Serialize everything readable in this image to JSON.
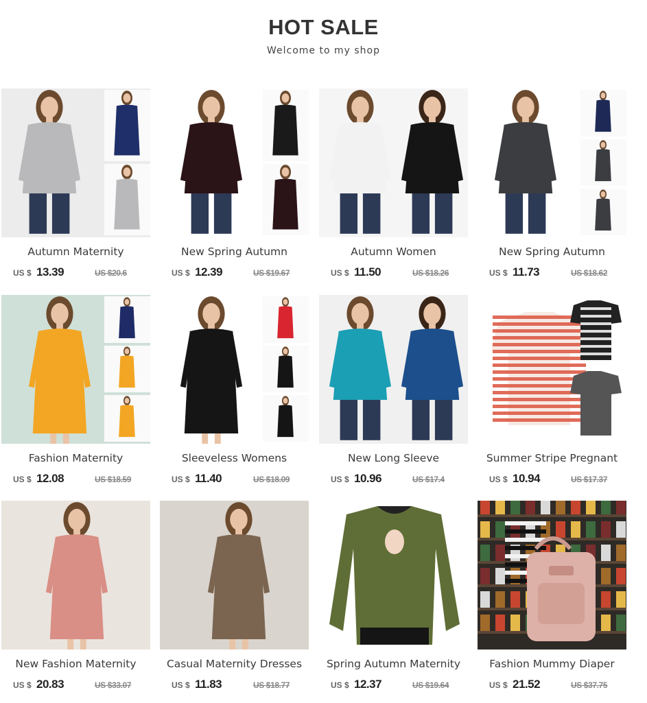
{
  "header": {
    "title": "HOT SALE",
    "subtitle": "Welcome to my shop"
  },
  "colors": {
    "text": "#333333",
    "price": "#222222",
    "old_price": "#888888"
  },
  "products": [
    {
      "name": "Autumn Maternity",
      "currency": "US $",
      "price": "13.39",
      "old_price": "US $20.6",
      "image": "grey-hoodie-maternity",
      "garment": "#b9b9bb",
      "accent": "#1f2f6a"
    },
    {
      "name": "New Spring Autumn",
      "currency": "US $",
      "price": "12.39",
      "old_price": "US $19.67",
      "image": "floral-wrap-top",
      "garment": "#2a1418",
      "accent": "#1a1a1a"
    },
    {
      "name": "Autumn Women",
      "currency": "US $",
      "price": "11.50",
      "old_price": "US $18.26",
      "image": "white-black-nursing-tops",
      "garment": "#f2f2f2",
      "accent": "#151515"
    },
    {
      "name": "New Spring Autumn",
      "currency": "US $",
      "price": "11.73",
      "old_price": "US $18.62",
      "image": "charcoal-wrap-top",
      "garment": "#3b3d40",
      "accent": "#1e2a55"
    },
    {
      "name": "Fashion Maternity",
      "currency": "US $",
      "price": "12.08",
      "old_price": "US $18.59",
      "image": "yellow-dress",
      "garment": "#f2a623",
      "accent": "#1f2b66"
    },
    {
      "name": "Sleeveless Womens",
      "currency": "US $",
      "price": "11.40",
      "old_price": "US $18.09",
      "image": "black-sleeveless-dress",
      "garment": "#151515",
      "accent": "#d8252f"
    },
    {
      "name": "New Long Sleeve",
      "currency": "US $",
      "price": "10.96",
      "old_price": "US $17.4",
      "image": "teal-long-sleeve",
      "garment": "#1b9fb4",
      "accent": "#1c4f8c"
    },
    {
      "name": "Summer Stripe Pregnant",
      "currency": "US $",
      "price": "10.94",
      "old_price": "US $17.37",
      "image": "striped-tee",
      "garment": "#dd5c47",
      "accent": "#2a2a2a"
    },
    {
      "name": "New Fashion Maternity",
      "currency": "US $",
      "price": "20.83",
      "old_price": "US $33.07",
      "image": "pink-pleated-dress",
      "garment": "#d98f86",
      "accent": "#f3efe9"
    },
    {
      "name": "Casual Maternity Dresses",
      "currency": "US $",
      "price": "11.83",
      "old_price": "US $18.77",
      "image": "brown-jumpsuit",
      "garment": "#7b6550",
      "accent": "#e9e6e1"
    },
    {
      "name": "Spring Autumn Maternity",
      "currency": "US $",
      "price": "12.37",
      "old_price": "US $19.64",
      "image": "olive-nursing-top",
      "garment": "#5f6e36",
      "accent": "#ffffff"
    },
    {
      "name": "Fashion Mummy Diaper",
      "currency": "US $",
      "price": "21.52",
      "old_price": "US $37.75",
      "image": "pink-diaper-backpack",
      "garment": "#ddb1a7",
      "accent": "#2b2b2b"
    }
  ]
}
